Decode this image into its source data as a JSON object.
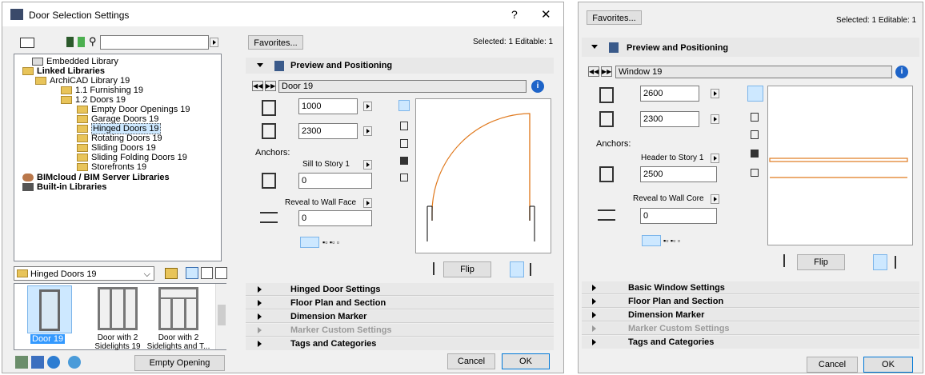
{
  "dialog": {
    "title": "Door Selection Settings",
    "help": "?",
    "close": "✕"
  },
  "library_tree": {
    "search_placeholder": "",
    "items": [
      {
        "label": "Embedded Library",
        "bold": false
      },
      {
        "label": "Linked Libraries",
        "bold": true
      },
      {
        "label": "ArchiCAD Library 19",
        "bold": false
      },
      {
        "label": "1.1 Furnishing 19",
        "bold": false
      },
      {
        "label": "1.2 Doors 19",
        "bold": false
      },
      {
        "label": "Empty Door Openings 19",
        "bold": false
      },
      {
        "label": "Garage Doors 19",
        "bold": false
      },
      {
        "label": "Hinged Doors 19",
        "bold": false
      },
      {
        "label": "Rotating Doors 19",
        "bold": false
      },
      {
        "label": "Sliding Doors 19",
        "bold": false
      },
      {
        "label": "Sliding Folding Doors 19",
        "bold": false
      },
      {
        "label": "Storefronts 19",
        "bold": false
      },
      {
        "label": "BIMcloud / BIM Server Libraries",
        "bold": true
      },
      {
        "label": "Built-in Libraries",
        "bold": true
      }
    ]
  },
  "folder_select": {
    "value": "Hinged Doors 19"
  },
  "thumbnails": [
    {
      "label": "Door 19",
      "selected": true
    },
    {
      "label": "Door with 2 Sidelights 19",
      "selected": false
    },
    {
      "label": "Door with 2 Sidelights and T...",
      "selected": false
    }
  ],
  "empty_opening_label": "Empty Opening",
  "left_panel": {
    "favorites": "Favorites...",
    "selected_info": "Selected: 1 Editable: 1",
    "section_title": "Preview and Positioning",
    "object_name": "Door 19",
    "width": "1000",
    "height": "2300",
    "anchors_label": "Anchors:",
    "anchor1": "Sill to Story 1",
    "anchor1_value": "0",
    "anchor2": "Reveal to Wall Face",
    "anchor2_value": "0",
    "flip": "Flip",
    "sections": [
      {
        "label": "Hinged Door Settings",
        "disabled": false
      },
      {
        "label": "Floor Plan and Section",
        "disabled": false
      },
      {
        "label": "Dimension Marker",
        "disabled": false
      },
      {
        "label": "Marker Custom Settings",
        "disabled": true
      },
      {
        "label": "Tags and Categories",
        "disabled": false
      }
    ],
    "cancel": "Cancel",
    "ok": "OK"
  },
  "right_panel": {
    "favorites": "Favorites...",
    "selected_info": "Selected: 1 Editable: 1",
    "section_title": "Preview and Positioning",
    "object_name": "Window 19",
    "width": "2600",
    "height": "2300",
    "anchors_label": "Anchors:",
    "anchor1": "Header to Story 1",
    "anchor1_value": "2500",
    "anchor2": "Reveal to Wall Core",
    "anchor2_value": "0",
    "flip": "Flip",
    "sections": [
      {
        "label": "Basic Window Settings",
        "disabled": false
      },
      {
        "label": "Floor Plan and Section",
        "disabled": false
      },
      {
        "label": "Dimension Marker",
        "disabled": false
      },
      {
        "label": "Marker Custom Settings",
        "disabled": true
      },
      {
        "label": "Tags and Categories",
        "disabled": false
      }
    ],
    "cancel": "Cancel",
    "ok": "OK"
  },
  "colors": {
    "preview_line": "#e07a1f",
    "selection": "#cde8ff",
    "info_icon": "#1e64c8"
  }
}
